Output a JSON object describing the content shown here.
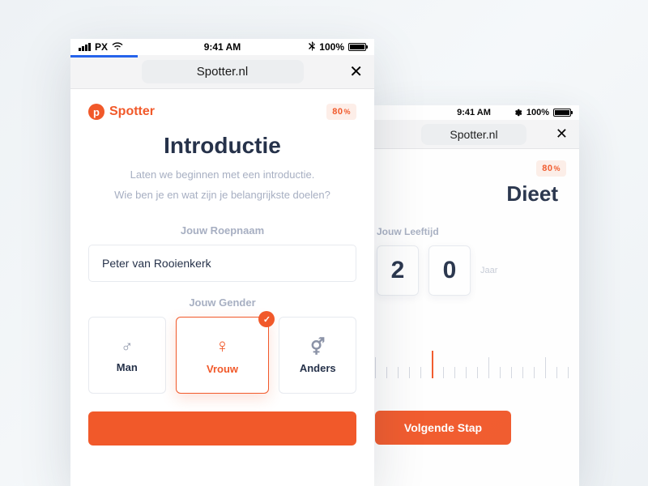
{
  "status": {
    "carrier": "PX",
    "time": "9:41 AM",
    "battery_pct": "100%"
  },
  "browser": {
    "url": "Spotter.nl"
  },
  "brand": {
    "name": "Spotter",
    "logo_letter": "p"
  },
  "progress_badge": {
    "value": "80",
    "unit": "%"
  },
  "front": {
    "title": "Introductie",
    "subtitle_line1": "Laten we beginnen met een introductie.",
    "subtitle_line2": "Wie ben je en wat zijn je belangrijkste doelen?",
    "name_field": {
      "label": "Jouw Roepnaam",
      "value": "Peter van Rooienkerk"
    },
    "gender_field": {
      "label": "Jouw Gender",
      "options": [
        {
          "label": "Man"
        },
        {
          "label": "Vrouw"
        },
        {
          "label": "Anders"
        }
      ],
      "selected_index": 1
    }
  },
  "back": {
    "title": "Dieet",
    "age_field": {
      "label": "Jouw Leeftijd",
      "digits": [
        "2",
        "0"
      ],
      "unit": "Jaar"
    },
    "cta_label": "Volgende Stap"
  },
  "colors": {
    "accent": "#f1592a",
    "text_primary": "#26324a",
    "text_muted": "#a7afc2"
  }
}
